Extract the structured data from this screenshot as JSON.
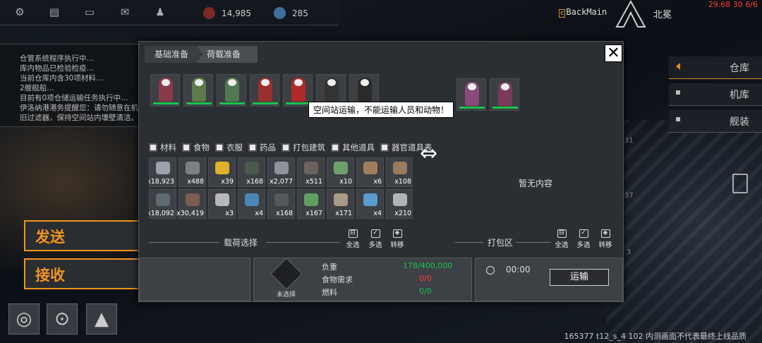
{
  "topbar": {
    "icons": [
      "gear-icon",
      "chat-icon",
      "message-icon",
      "mail-icon",
      "profile-icon"
    ],
    "res1": "14,985",
    "res2": "285"
  },
  "header": {
    "back": "BackMain",
    "back_badge": "c",
    "place": "北冕",
    "fps": "29.68 30 6/6"
  },
  "log": [
    "仓管系统程序执行中…",
    "库内物品已检验检疫…",
    "当前仓库内含30项材料…",
    "2艘舰船…",
    "目前有0项仓储运输任务执行中…",
    "伊洛纳港港务提醒您：请勿随意在机",
    "旧过滤器，保持空间站内壤壁清洁。"
  ],
  "left_buttons": {
    "send": "发送",
    "receive": "接收"
  },
  "side": [
    "仓库",
    "机库",
    "舰装"
  ],
  "bg_numbers": [
    "31",
    "37",
    "3"
  ],
  "dialog": {
    "tab1": "基础准备",
    "tab2": "荷载准备",
    "close": "✕",
    "tooltip": "空间站运输，不能运输人员和动物！",
    "filters": [
      "材料",
      "食物",
      "衣服",
      "药品",
      "打包建筑",
      "其他道具",
      "器官道具表"
    ],
    "swap": "⇔",
    "items": [
      {
        "q": "x18,923",
        "c": "#9aa3ad"
      },
      {
        "q": "x488",
        "c": "#7d7f83"
      },
      {
        "q": "x39",
        "c": "#e0b22a"
      },
      {
        "q": "x168",
        "c": "#4b5a4c"
      },
      {
        "q": "x2,077",
        "c": "#8d939a"
      },
      {
        "q": "x511",
        "c": "#6d625c"
      },
      {
        "q": "x10",
        "c": "#6fa06a"
      },
      {
        "q": "x6",
        "c": "#a07e5c"
      },
      {
        "q": "x108",
        "c": "#9b7b5e"
      },
      {
        "q": "x18,092",
        "c": "#5e6a70"
      },
      {
        "q": "x30,419",
        "c": "#7a5c52"
      },
      {
        "q": "x3",
        "c": "#b8b8b8"
      },
      {
        "q": "x4",
        "c": "#4a86b8"
      },
      {
        "q": "x168",
        "c": "#55585c"
      },
      {
        "q": "x167",
        "c": "#5fa05f"
      },
      {
        "q": "x171",
        "c": "#a89a86"
      },
      {
        "q": "x4",
        "c": "#5a9bd0"
      },
      {
        "q": "x210",
        "c": "#b0b4b8"
      }
    ],
    "empty": "暂无内容",
    "left_label": "载荷选择",
    "right_label": "打包区",
    "actions": [
      "全选",
      "多选",
      "转移"
    ],
    "ship_label": "未选择",
    "stats": [
      {
        "k": "负重",
        "v": "178/400,000",
        "c": "#19c34a"
      },
      {
        "k": "食物需求",
        "v": "0/0",
        "c": "#ff3b3b"
      },
      {
        "k": "燃料",
        "v": "0/0",
        "c": "#19c34a"
      }
    ],
    "time": "00:00",
    "transport": "运输"
  },
  "version": "165377 t12_s_4 102  内测画面不代表最终上线品质"
}
